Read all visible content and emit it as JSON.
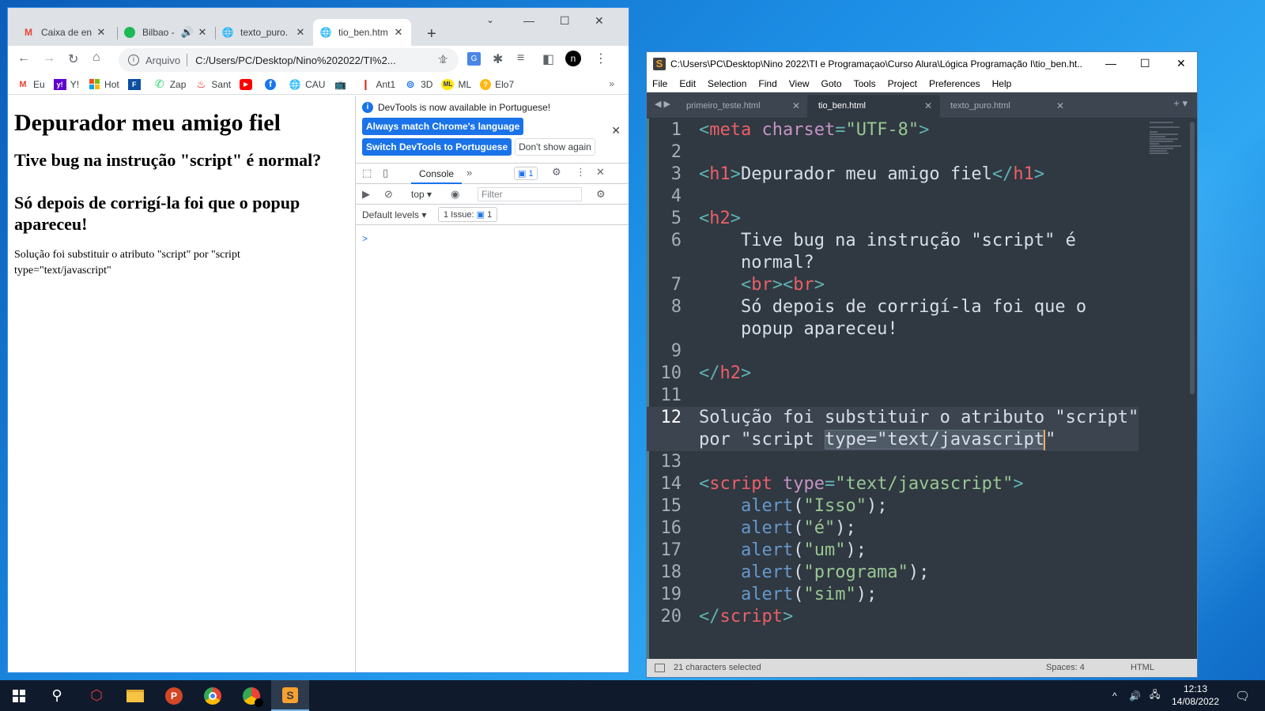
{
  "chrome": {
    "tabs": [
      {
        "title": "Caixa de en",
        "icon": "gmail-icon"
      },
      {
        "title": "Bilbao -",
        "icon": "spotify-icon"
      },
      {
        "title": "texto_puro.",
        "icon": "globe-icon"
      },
      {
        "title": "tio_ben.htm",
        "icon": "globe-icon"
      }
    ],
    "toolbar": {
      "scheme_label": "Arquivo",
      "url": "C:/Users/PC/Desktop/Nino%202022/TI%2..."
    },
    "bookmarks": [
      "Eu",
      "Y!",
      "Hot",
      "",
      "Zap",
      "Sant",
      "",
      "",
      "CAU",
      "",
      "Ant1",
      "3D",
      "ML",
      "Elo7"
    ],
    "page": {
      "h1": "Depurador meu amigo fiel",
      "h2a": "Tive bug na instrução \"script\" é normal?",
      "h2b": "Só depois de corrigí-la foi que o popup apareceu!",
      "p": "Solução foi substituir o atributo \"script\" por \"script type=\"text/javascript\""
    },
    "devtools": {
      "info": "DevTools is now available in Portuguese!",
      "btn_match": "Always match Chrome's language",
      "btn_switch": "Switch DevTools to Portuguese",
      "btn_dont": "Don't show again",
      "console_tab": "Console",
      "badge": "1",
      "context": "top",
      "filter_placeholder": "Filter",
      "levels": "Default levels",
      "issue": "1 Issue:",
      "issue_count": "1",
      "prompt": ">"
    }
  },
  "sublime": {
    "title": "C:\\Users\\PC\\Desktop\\Nino 2022\\TI e Programaçao\\Curso Alura\\Lógica Programação I\\tio_ben.ht...",
    "menu": [
      "File",
      "Edit",
      "Selection",
      "Find",
      "View",
      "Goto",
      "Tools",
      "Project",
      "Preferences",
      "Help"
    ],
    "tabs": [
      "primeiro_teste.html",
      "tio_ben.html",
      "texto_puro.html"
    ],
    "status": {
      "selection": "21 characters selected",
      "spaces": "Spaces: 4",
      "syntax": "HTML"
    }
  },
  "taskbar": {
    "time": "12:13",
    "date": "14/08/2022"
  },
  "colors": {
    "sublime_bg": "#303841",
    "chrome_blue": "#1a73e8",
    "taskbar": "#0f1b2d"
  }
}
